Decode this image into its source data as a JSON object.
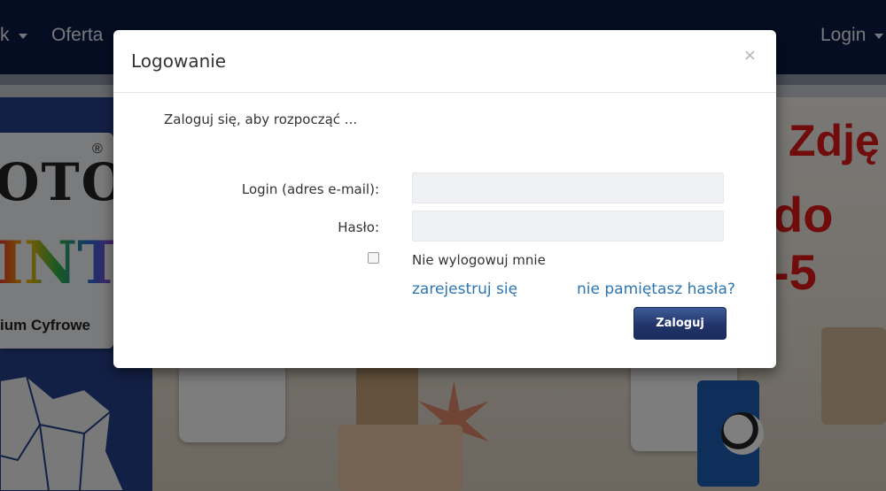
{
  "nav": {
    "items": [
      {
        "label": "k",
        "caret": true
      },
      {
        "label": "Oferta",
        "caret": false
      }
    ],
    "login_label": "Login"
  },
  "sidebar": {
    "logo_top": "OTO",
    "logo_mid": "INT",
    "logo_sub": "ium Cyfrowe",
    "logo_mark": "®"
  },
  "banner": {
    "headline": "Zdję",
    "promo": "do -5",
    "prev_arrow": "‹"
  },
  "modal": {
    "title": "Logowanie",
    "close_glyph": "×",
    "intro": "Zaloguj się, aby rozpocząć ...",
    "login_label": "Login (adres e-mail):",
    "login_value": "",
    "password_label": "Hasło:",
    "password_value": "",
    "remember_label": "Nie wylogowuj mnie",
    "remember_checked": false,
    "register_link": "zarejestruj się",
    "forgot_link": "nie pamiętasz hasła?",
    "submit_label": "Zaloguj"
  },
  "colors": {
    "nav_bg": "#0b1a44",
    "link": "#2c76b4",
    "button": "#22356b",
    "promo_red": "#e01818"
  }
}
